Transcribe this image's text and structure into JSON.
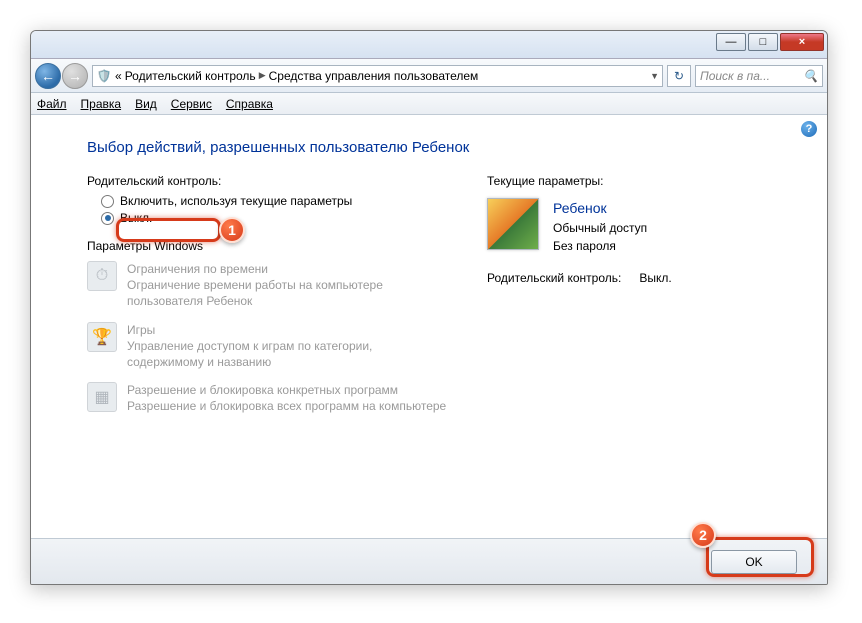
{
  "window": {
    "min": "—",
    "max": "□",
    "close": "×"
  },
  "breadcrumb": {
    "prefix": "«",
    "item1": "Родительский контроль",
    "item2": "Средства управления пользователем"
  },
  "search": {
    "placeholder": "Поиск в па..."
  },
  "menu": {
    "file": "Файл",
    "edit": "Правка",
    "view": "Вид",
    "tools": "Сервис",
    "help": "Справка"
  },
  "heading": "Выбор действий, разрешенных пользователю Ребенок",
  "leftcol": {
    "pc_label": "Родительский контроль:",
    "radio_on": "Включить, используя текущие параметры",
    "radio_off": "Выкл.",
    "win_params": "Параметры Windows",
    "time_title": "Ограничения по времени",
    "time_desc": "Ограничение времени работы на компьютере пользователя Ребенок",
    "games_title": "Игры",
    "games_desc": "Управление доступом к играм по категории, содержимому и названию",
    "apps_title": "Разрешение и блокировка конкретных программ",
    "apps_desc": "Разрешение и блокировка всех программ на компьютере"
  },
  "rightcol": {
    "cur_params": "Текущие параметры:",
    "username": "Ребенок",
    "usertype": "Обычный доступ",
    "userpass": "Без пароля",
    "pc_label": "Родительский контроль:",
    "pc_state": "Выкл."
  },
  "buttons": {
    "ok": "OK"
  },
  "markers": {
    "m1": "1",
    "m2": "2"
  }
}
